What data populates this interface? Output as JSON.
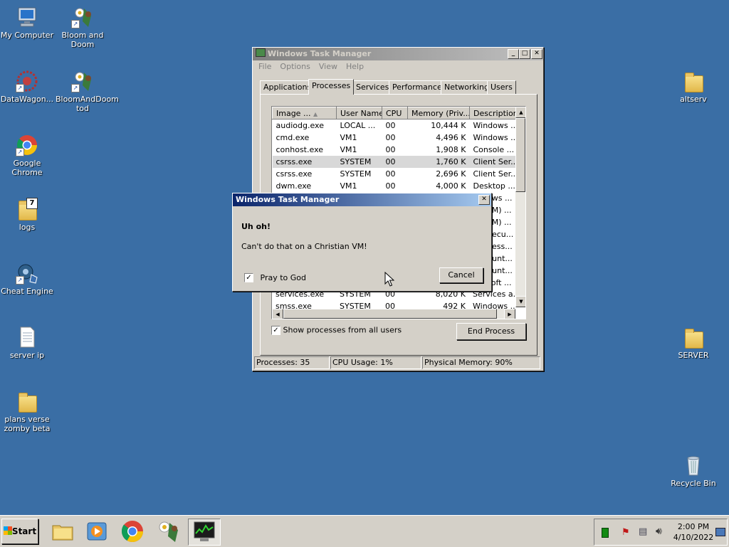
{
  "desktop": {
    "icons": [
      {
        "label": "My Computer"
      },
      {
        "label": "Bloom and Doom"
      },
      {
        "label": "DataWagon..."
      },
      {
        "label": "BloomAndDoom tod"
      },
      {
        "label": "Google Chrome"
      },
      {
        "label": "logs"
      },
      {
        "label": "Cheat Engine"
      },
      {
        "label": "server ip"
      },
      {
        "label": "plans verse zomby beta"
      },
      {
        "label": "altserv"
      },
      {
        "label": "SERVER"
      },
      {
        "label": "Recycle Bin"
      }
    ]
  },
  "task_manager": {
    "title": "Windows Task Manager",
    "menu": [
      "File",
      "Options",
      "View",
      "Help"
    ],
    "tabs": [
      "Applications",
      "Processes",
      "Services",
      "Performance",
      "Networking",
      "Users"
    ],
    "active_tab": "Processes",
    "columns": [
      "Image ...",
      "User Name",
      "CPU",
      "Memory (Priv...",
      "Description"
    ],
    "rows": [
      [
        "audiodg.exe",
        "LOCAL ...",
        "00",
        "10,444 K",
        "Windows ..."
      ],
      [
        "cmd.exe",
        "VM1",
        "00",
        "4,496 K",
        "Windows ..."
      ],
      [
        "conhost.exe",
        "VM1",
        "00",
        "1,908 K",
        "Console ..."
      ],
      [
        "csrss.exe",
        "SYSTEM",
        "00",
        "1,760 K",
        "Client Ser..."
      ],
      [
        "csrss.exe",
        "SYSTEM",
        "00",
        "2,696 K",
        "Client Ser..."
      ],
      [
        "dwm.exe",
        "VM1",
        "00",
        "4,000 K",
        "Desktop ..."
      ]
    ],
    "hidden_desc_fragments": [
      "ows ...",
      "TM) ...",
      "TM) ...",
      "Secu...",
      "Sess...",
      "Runt...",
      "Runt...",
      "soft ..."
    ],
    "bottom_rows": [
      [
        "services.exe",
        "SYSTEM",
        "00",
        "8,020 K",
        "Services a..."
      ],
      [
        "smss.exe",
        "SYSTEM",
        "00",
        "492 K",
        "Windows ..."
      ]
    ],
    "show_all_label": "Show processes from all users",
    "end_process_label": "End Process",
    "status": {
      "processes": "Processes: 35",
      "cpu": "CPU Usage: 1%",
      "memory": "Physical Memory: 90%"
    }
  },
  "dialog": {
    "title": "Windows Task Manager",
    "heading": "Uh oh!",
    "message": "Can't do that on a Christian VM!",
    "checkbox_label": "Pray to God",
    "cancel_label": "Cancel"
  },
  "taskbar": {
    "start_label": "Start",
    "clock_time": "2:00 PM",
    "clock_date": "4/10/2022"
  },
  "colors": {
    "desktop": "#3a6ea5",
    "active_title": "#0a246a",
    "chrome": "#d4d0c8"
  }
}
